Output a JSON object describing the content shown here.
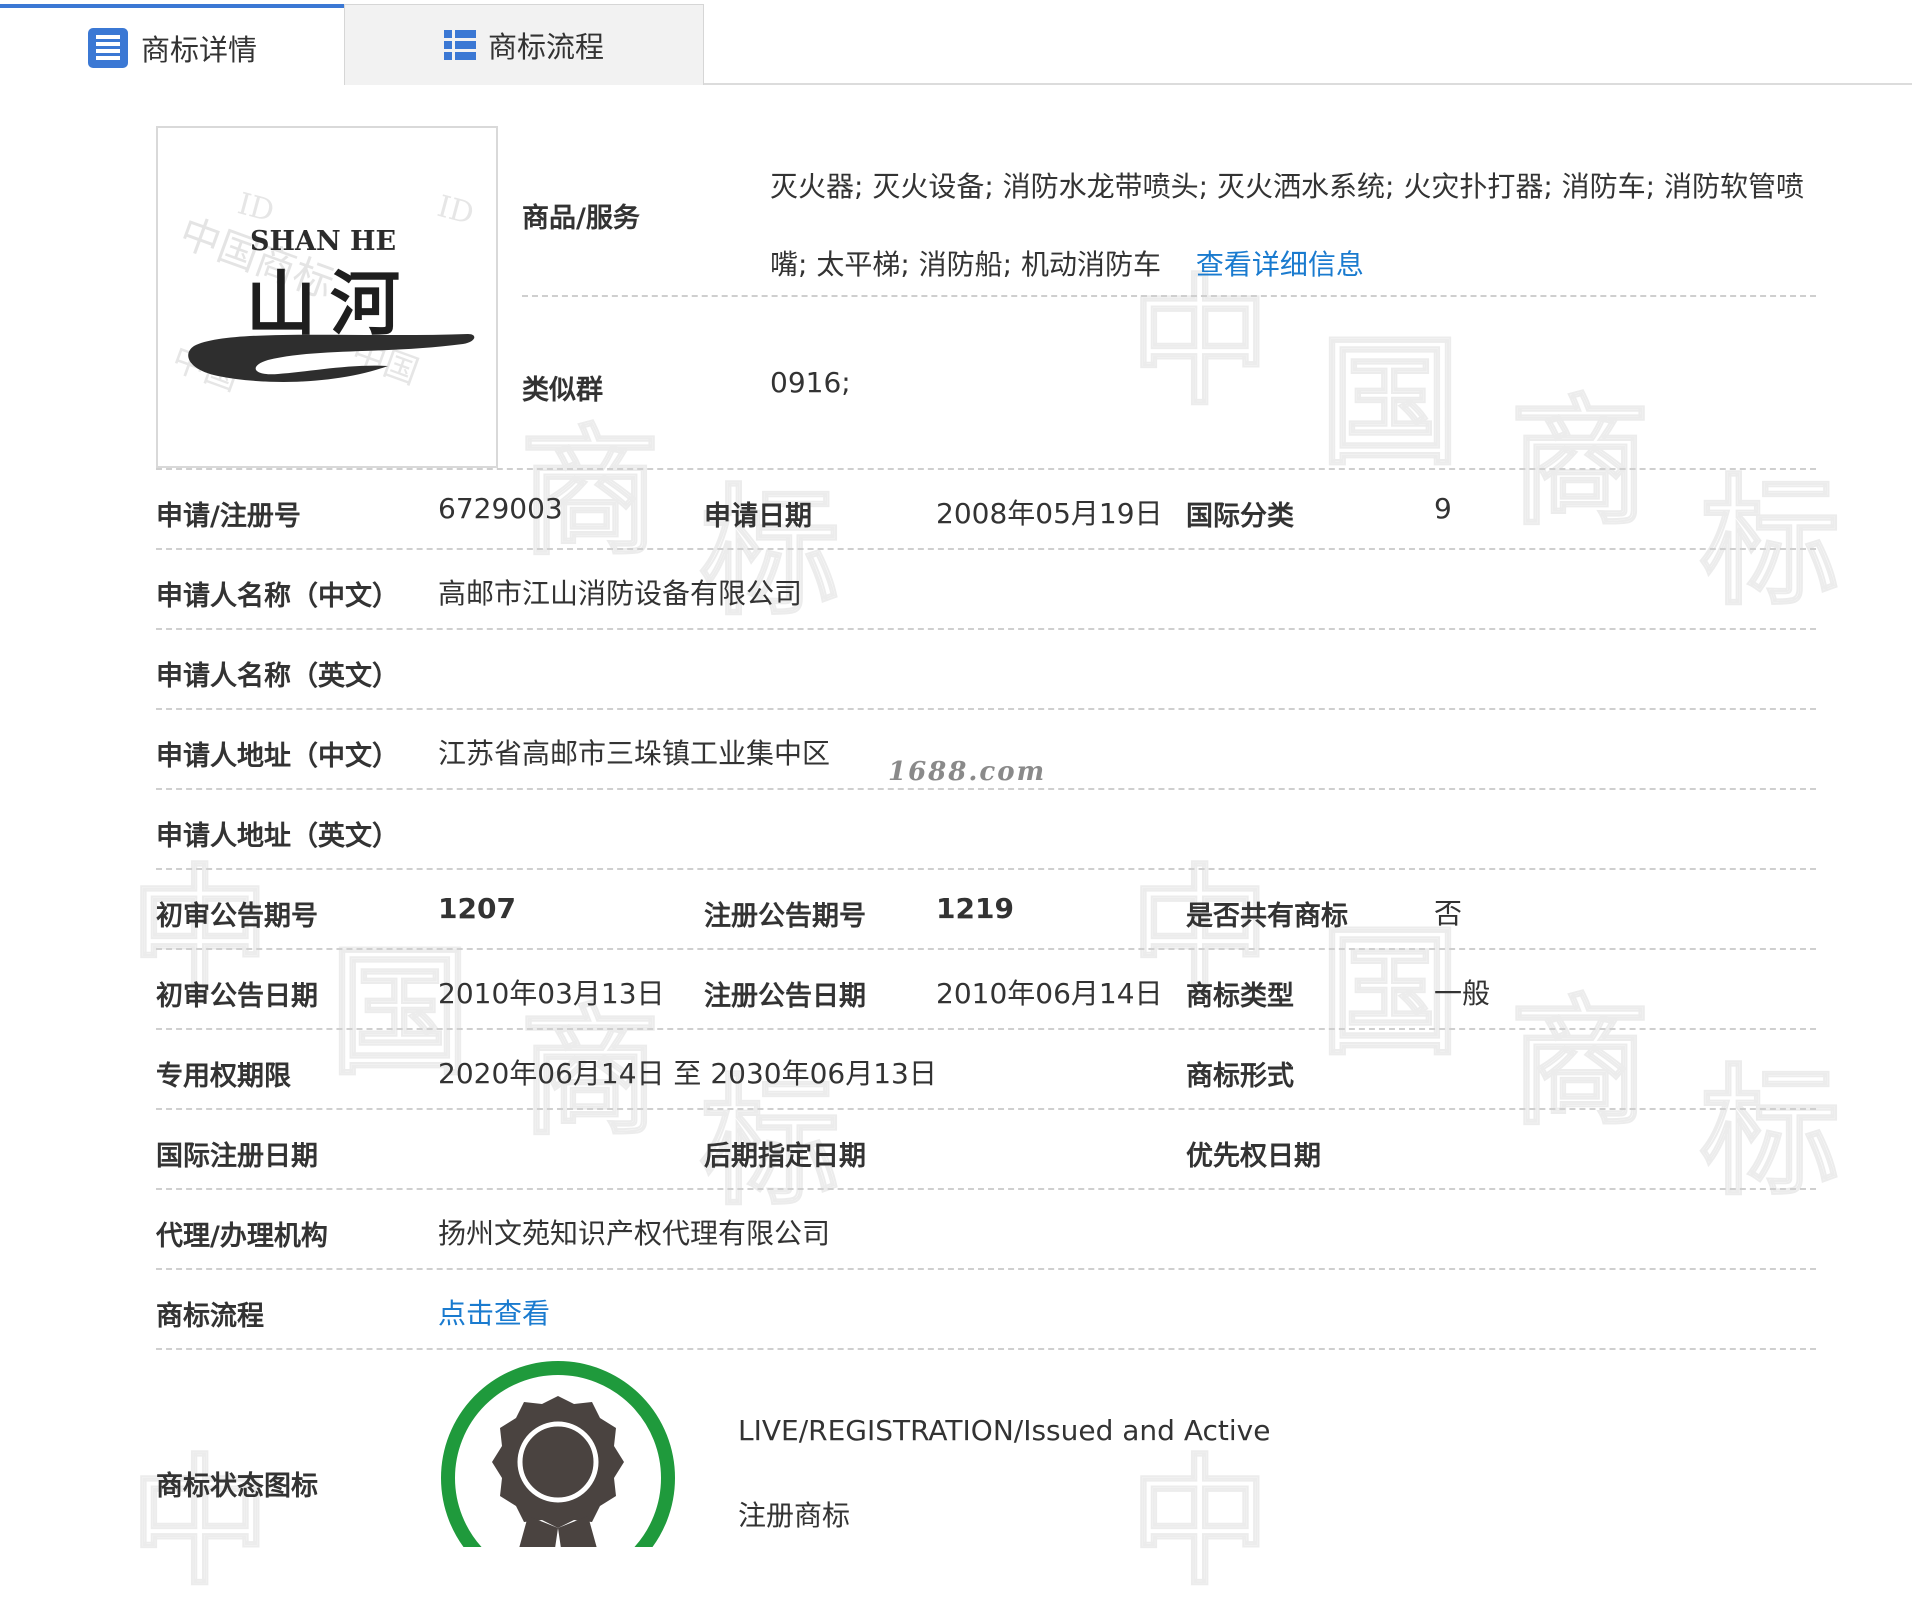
{
  "tabs": [
    {
      "label": "商标详情",
      "icon": "document-list-icon",
      "active": true
    },
    {
      "label": "商标流程",
      "icon": "grid-list-icon",
      "active": false
    }
  ],
  "logo": {
    "latin": "SHAN HE",
    "chinese": "山河"
  },
  "watermark": {
    "site": "1688.com"
  },
  "goods": {
    "label": "商品/服务",
    "text": "灭火器; 灭火设备; 消防水龙带喷头; 灭火洒水系统; 火灾扑打器; 消防车; 消防软管喷嘴; 太平梯; 消防船; 机动消防车",
    "detail_link": "查看详细信息"
  },
  "similar_group": {
    "label": "类似群",
    "value": "0916;"
  },
  "reg_no": {
    "label": "申请/注册号",
    "value": "6729003"
  },
  "apply_date": {
    "label": "申请日期",
    "value": "2008年05月19日"
  },
  "intl_class": {
    "label": "国际分类",
    "value": "9"
  },
  "applicant_cn": {
    "label": "申请人名称（中文）",
    "value": "高邮市江山消防设备有限公司"
  },
  "applicant_en": {
    "label": "申请人名称（英文）",
    "value": ""
  },
  "address_cn": {
    "label": "申请人地址（中文）",
    "value": "江苏省高邮市三垛镇工业集中区"
  },
  "address_en": {
    "label": "申请人地址（英文）",
    "value": ""
  },
  "prelim_issue": {
    "label": "初审公告期号",
    "value": "1207"
  },
  "reg_issue": {
    "label": "注册公告期号",
    "value": "1219"
  },
  "shared": {
    "label": "是否共有商标",
    "value": "否"
  },
  "prelim_date": {
    "label": "初审公告日期",
    "value": "2010年03月13日"
  },
  "reg_date": {
    "label": "注册公告日期",
    "value": "2010年06月14日"
  },
  "tm_type": {
    "label": "商标类型",
    "value": "一般"
  },
  "exclusive_period": {
    "label": "专用权期限",
    "value": "2020年06月14日 至 2030年06月13日"
  },
  "tm_form": {
    "label": "商标形式",
    "value": ""
  },
  "intl_reg_date": {
    "label": "国际注册日期",
    "value": ""
  },
  "later_designation": {
    "label": "后期指定日期",
    "value": ""
  },
  "priority_date": {
    "label": "优先权日期",
    "value": ""
  },
  "agency": {
    "label": "代理/办理机构",
    "value": "扬州文苑知识产权代理有限公司"
  },
  "process": {
    "label": "商标流程",
    "link": "点击查看"
  },
  "status": {
    "label": "商标状态图标",
    "text_en": "LIVE/REGISTRATION/Issued and Active",
    "text_cn": "注册商标",
    "badge_icon": "registration-seal-icon",
    "ring_color": "#1f9a3c"
  },
  "colors": {
    "accent": "#3b78d4",
    "link": "#1a7bcf"
  }
}
